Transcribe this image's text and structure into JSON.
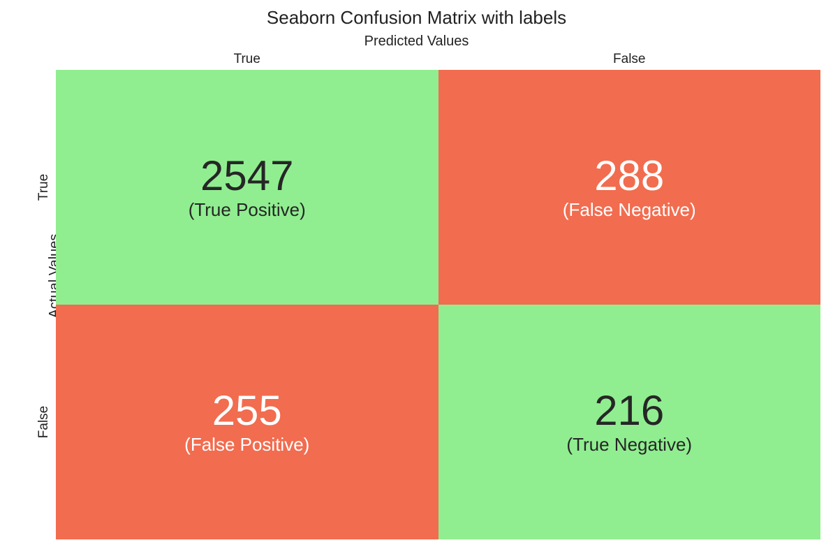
{
  "chart_data": {
    "type": "heatmap",
    "title": "Seaborn Confusion Matrix with labels",
    "xlabel": "Predicted Values",
    "ylabel": "Actual Values",
    "col_categories": [
      "True",
      "False"
    ],
    "row_categories": [
      "True",
      "False"
    ],
    "cells": [
      {
        "row": "True",
        "col": "True",
        "value": 2547,
        "label": "(True Positive)",
        "color": "#90ee90",
        "text_color": "#262626"
      },
      {
        "row": "True",
        "col": "False",
        "value": 288,
        "label": "(False Negative)",
        "color": "#f26c4f",
        "text_color": "#ffffff"
      },
      {
        "row": "False",
        "col": "True",
        "value": 255,
        "label": "(False Positive)",
        "color": "#f26c4f",
        "text_color": "#ffffff"
      },
      {
        "row": "False",
        "col": "False",
        "value": 216,
        "label": "(True Negative)",
        "color": "#90ee90",
        "text_color": "#262626"
      }
    ]
  }
}
